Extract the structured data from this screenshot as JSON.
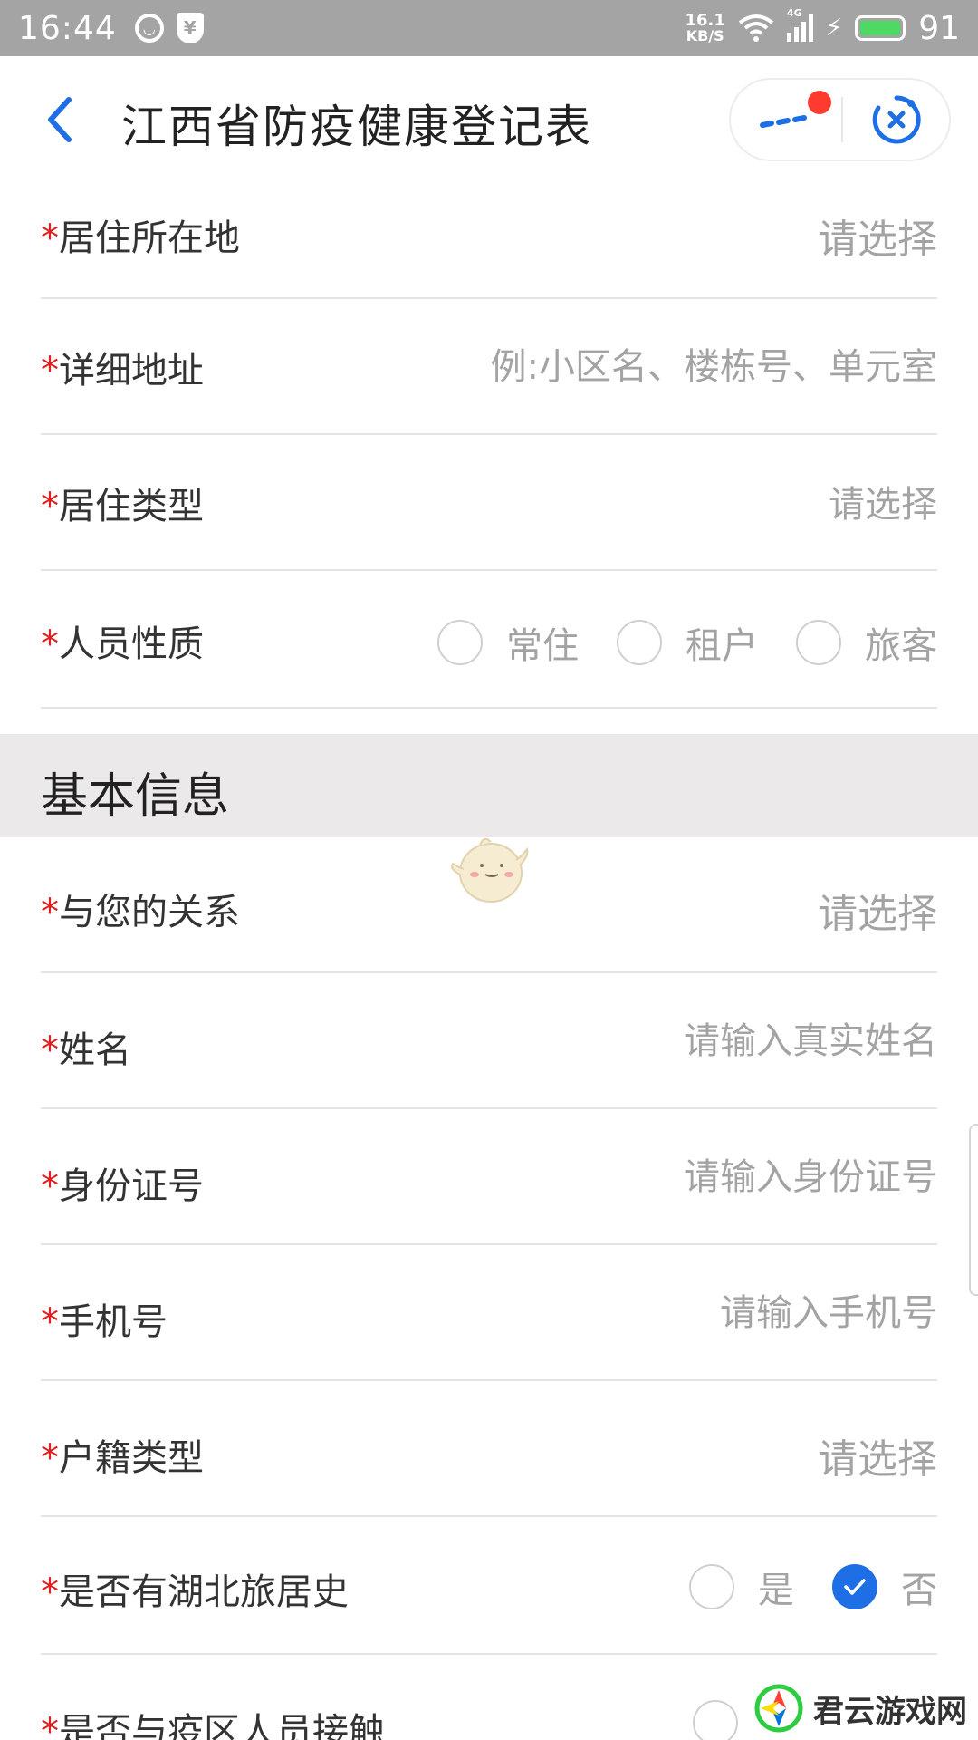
{
  "status_bar": {
    "time": "16:44",
    "net_speed_value": "16.1",
    "net_speed_unit": "KB/S",
    "network_type": "4G",
    "battery_level": "91",
    "battery_color": "#4cd964"
  },
  "header": {
    "title": "江西省防疫健康登记表",
    "back_icon": "chevron-left-icon",
    "more_icon": "more-dots-icon",
    "close_icon": "close-target-icon",
    "accent": "#1e6fe6"
  },
  "address_fields": [
    {
      "label": "居住所在地",
      "value": "请选择"
    },
    {
      "label": "详细地址",
      "placeholder": "例:小区名、楼栋号、单元室"
    },
    {
      "label": "居住类型",
      "value": "请选择"
    },
    {
      "label": "人员性质",
      "options": [
        "常住",
        "租户",
        "旅客"
      ]
    }
  ],
  "section": {
    "title": "基本信息"
  },
  "basic_fields": [
    {
      "label": "与您的关系",
      "value": "请选择"
    },
    {
      "label": "姓名",
      "placeholder": "请输入真实姓名"
    },
    {
      "label": "身份证号",
      "placeholder": "请输入身份证号"
    },
    {
      "label": "手机号",
      "placeholder": "请输入手机号"
    },
    {
      "label": "户籍类型",
      "value": "请选择"
    },
    {
      "label": "是否有湖北旅居史",
      "options": [
        "是",
        "否"
      ],
      "selected": "否"
    },
    {
      "label": "是否与疫区人员接触"
    }
  ],
  "required_mark": "*",
  "watermark": {
    "text": "君云游戏网"
  }
}
